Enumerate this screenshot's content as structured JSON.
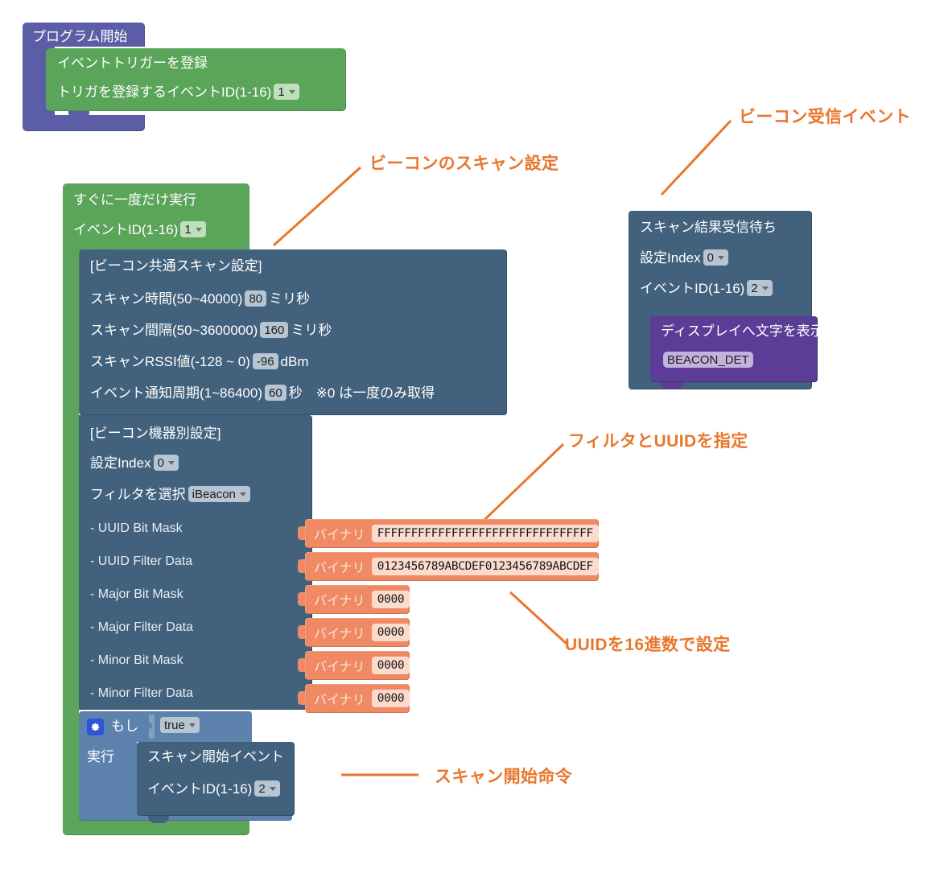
{
  "program_start": {
    "title": "プログラム開始"
  },
  "register_trigger": {
    "line1": "イベントトリガーを登録",
    "line2_label": "トリガを登録するイベントID(1-16)",
    "line2_value": "1"
  },
  "run_once": {
    "line1": "すぐに一度だけ実行",
    "line2_label": "イベントID(1-16)",
    "line2_value": "1"
  },
  "scan_common": {
    "header": "[ビーコン共通スキャン設定]",
    "rows": [
      {
        "label": "スキャン時間(50~40000)",
        "value": "80",
        "unit": "ミリ秒"
      },
      {
        "label": "スキャン間隔(50~3600000)",
        "value": "160",
        "unit": "ミリ秒"
      },
      {
        "label": "スキャンRSSI値(-128 ~ 0)",
        "value": "-96",
        "unit": "dBm"
      },
      {
        "label": "イベント通知周期(1~86400)",
        "value": "60",
        "unit": "秒　※0 は一度のみ取得"
      }
    ]
  },
  "device_setting": {
    "header": "[ビーコン機器別設定]",
    "index_label": "設定Index",
    "index_value": "0",
    "filter_label": "フィルタを選択",
    "filter_value": "iBeacon",
    "fields": [
      {
        "label": "- UUID Bit Mask",
        "binary_label": "バイナリ",
        "value": "FFFFFFFFFFFFFFFFFFFFFFFFFFFFFFFF"
      },
      {
        "label": "- UUID Filter Data",
        "binary_label": "バイナリ",
        "value": "0123456789ABCDEF0123456789ABCDEF"
      },
      {
        "label": "- Major Bit Mask",
        "binary_label": "バイナリ",
        "value": "0000"
      },
      {
        "label": "- Major Filter Data",
        "binary_label": "バイナリ",
        "value": "0000"
      },
      {
        "label": "- Minor Bit Mask",
        "binary_label": "バイナリ",
        "value": "0000"
      },
      {
        "label": "- Minor Filter Data",
        "binary_label": "バイナリ",
        "value": "0000"
      }
    ]
  },
  "if_block": {
    "if_label": "もし",
    "condition_value": "true",
    "do_label": "実行"
  },
  "scan_start": {
    "line1": "スキャン開始イベント",
    "line2_label": "イベントID(1-16)",
    "line2_value": "2"
  },
  "wait_scan": {
    "line1": "スキャン結果受信待ち",
    "index_label": "設定Index",
    "index_value": "0",
    "event_label": "イベントID(1-16)",
    "event_value": "2"
  },
  "display_text": {
    "line1": "ディスプレイへ文字を表示",
    "value": "BEACON_DET"
  },
  "annotations": {
    "scan_setting": "ビーコンのスキャン設定",
    "beacon_receive_event": "ビーコン受信イベント",
    "filter_and_uuid": "フィルタとUUIDを指定",
    "uuid_hex": "UUIDを16進数で設定",
    "scan_start_cmd": "スキャン開始命令"
  },
  "colors": {
    "start_purple": "#5b5ea6",
    "green": "#5ba55b",
    "slate": "#42617d",
    "steel": "#5c82ad",
    "salmon": "#f08a65",
    "purple": "#5b3c97",
    "annotation_orange": "#e8772e"
  }
}
